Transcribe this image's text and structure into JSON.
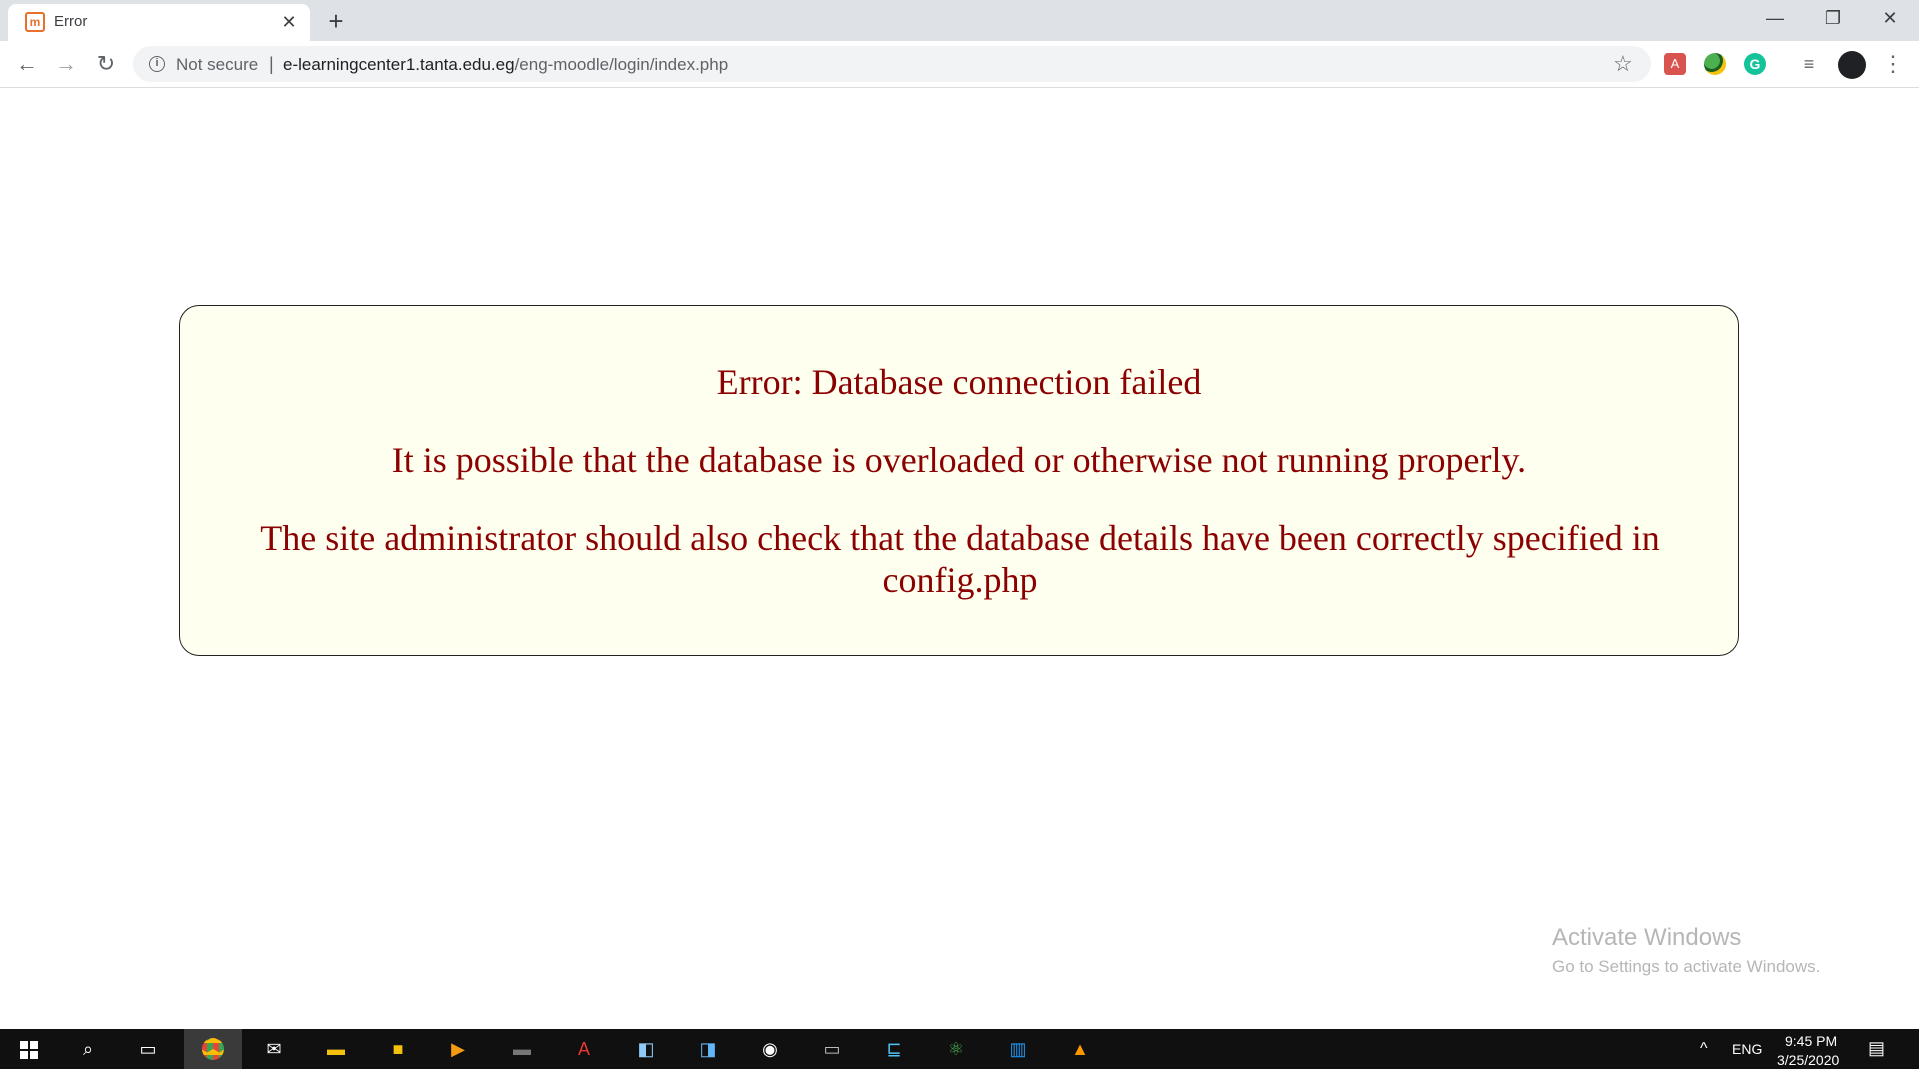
{
  "browser": {
    "tab_title": "Error",
    "tab_close": "✕",
    "new_tab": "+",
    "win_minimize": "—",
    "win_restore": "❐",
    "win_close": "✕",
    "security_label": "Not secure",
    "url_host": "e-learningcenter1.tanta.edu.eg",
    "url_path": "/eng-moodle/login/index.php"
  },
  "error": {
    "title": "Error: Database connection failed",
    "line1": "It is possible that the database is overloaded or otherwise not running properly.",
    "line2": "The site administrator should also check that the database details have been correctly specified in config.php"
  },
  "watermark": {
    "title": "Activate Windows",
    "subtitle": "Go to Settings to activate Windows."
  },
  "taskbar": {
    "language": "ENG",
    "time": "9:45 PM",
    "date": "3/25/2020"
  },
  "colors": {
    "error_text": "#8b0000",
    "error_bg": "#fffff0",
    "taskbar": "#101010"
  }
}
